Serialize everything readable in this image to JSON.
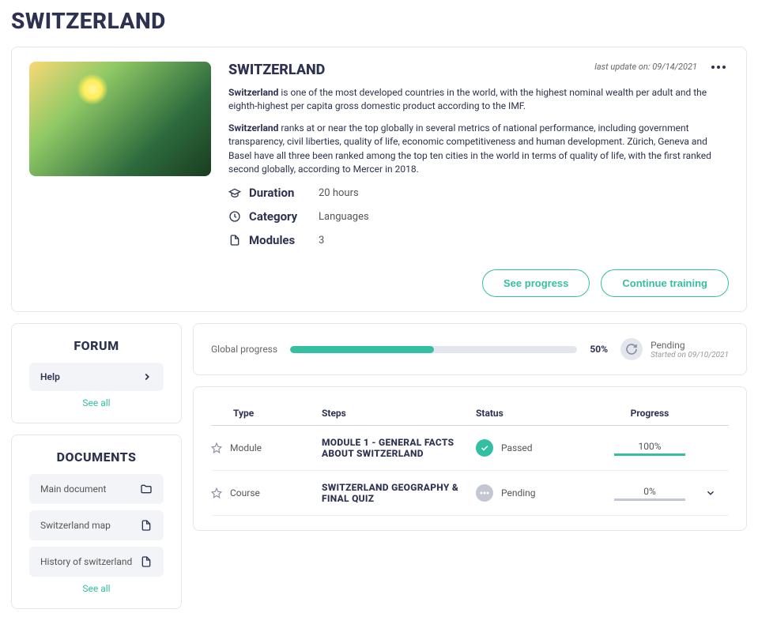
{
  "page_title": "SWITZERLAND",
  "hero": {
    "title": "SWITZERLAND",
    "last_update": "last update on: 09/14/2021",
    "desc1_bold": "Switzerland",
    "desc1_rest": " is one of the most developed countries in the world, with the highest nominal wealth per adult and the eighth-highest per capita gross domestic product according to the IMF.",
    "desc2_bold": "Switzerland",
    "desc2_rest": " ranks at or near the top globally in several metrics of national performance, including government transparency, civil liberties, quality of life, economic competitiveness and human development. Zürich, Geneva and Basel have all three been ranked among the top ten cities in the world in terms of quality of life, with the first ranked second globally, according to Mercer in 2018.",
    "meta": {
      "duration_label": "Duration",
      "duration_value": "20 hours",
      "category_label": "Category",
      "category_value": "Languages",
      "modules_label": "Modules",
      "modules_value": "3"
    },
    "actions": {
      "see_progress": "See progress",
      "continue": "Continue training"
    }
  },
  "forum": {
    "title": "FORUM",
    "items": [
      {
        "label": "Help"
      }
    ],
    "see_all": "See all"
  },
  "documents": {
    "title": "DOCUMENTS",
    "items": [
      {
        "label": "Main document",
        "icon": "folder"
      },
      {
        "label": "Switzerland map",
        "icon": "file"
      },
      {
        "label": "History of switzerland",
        "icon": "file"
      }
    ],
    "see_all": "See all"
  },
  "global_progress": {
    "label": "Global progress",
    "pct": "50%",
    "fill_pct": 50,
    "status": "Pending",
    "started": "Started on 09/10/2021"
  },
  "modules_table": {
    "headers": {
      "type": "Type",
      "steps": "Steps",
      "status": "Status",
      "progress": "Progress"
    },
    "rows": [
      {
        "type": "Module",
        "step": "MODULE 1 - GENERAL FACTS ABOUT SWITZERLAND",
        "status": "Passed",
        "status_kind": "passed",
        "progress": "100%",
        "progress_full": true,
        "expandable": false
      },
      {
        "type": "Course",
        "step": "SWITZERLAND GEOGRAPHY & FINAL QUIZ",
        "status": "Pending",
        "status_kind": "pending",
        "progress": "0%",
        "progress_full": false,
        "expandable": true
      }
    ]
  }
}
